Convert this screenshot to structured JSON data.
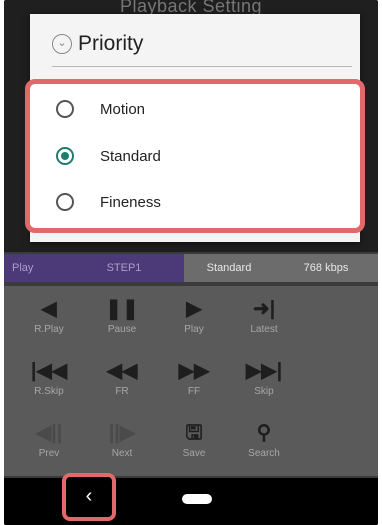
{
  "background": {
    "title": "Playback Setting"
  },
  "dialog": {
    "title": "Priority",
    "options": [
      {
        "label": "Motion",
        "selected": false
      },
      {
        "label": "Standard",
        "selected": true
      },
      {
        "label": "Fineness",
        "selected": false
      }
    ]
  },
  "status_bar": {
    "mode": "Play",
    "step": "STEP1",
    "quality": "Standard",
    "bitrate": "768 kbps"
  },
  "controls": [
    {
      "label": "R.Play",
      "icon": "reverse-play-icon",
      "glyph": "◀"
    },
    {
      "label": "Pause",
      "icon": "pause-icon",
      "glyph": "❚❚"
    },
    {
      "label": "Play",
      "icon": "play-icon",
      "glyph": "▶"
    },
    {
      "label": "Latest",
      "icon": "latest-icon",
      "glyph": "➜|"
    },
    {
      "label": "R.Skip",
      "icon": "reverse-skip-icon",
      "glyph": "|◀◀"
    },
    {
      "label": "FR",
      "icon": "fast-rewind-icon",
      "glyph": "◀◀"
    },
    {
      "label": "FF",
      "icon": "fast-forward-icon",
      "glyph": "▶▶"
    },
    {
      "label": "Skip",
      "icon": "skip-icon",
      "glyph": "▶▶|"
    },
    {
      "label": "Prev",
      "icon": "prev-frame-icon",
      "glyph": "◀||"
    },
    {
      "label": "Next",
      "icon": "next-frame-icon",
      "glyph": "||▶"
    },
    {
      "label": "Save",
      "icon": "save-icon",
      "glyph": "🖫"
    },
    {
      "label": "Search",
      "icon": "search-icon",
      "glyph": "⚲"
    }
  ],
  "navbar": {
    "back_glyph": "‹"
  }
}
